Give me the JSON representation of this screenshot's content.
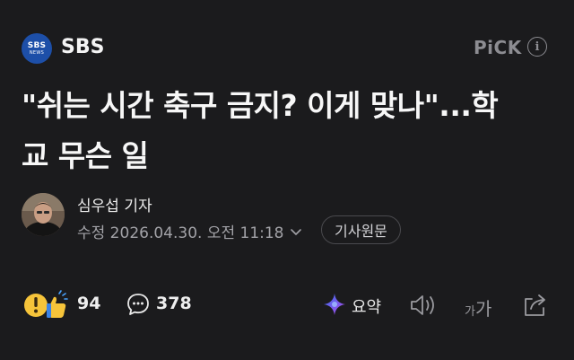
{
  "press": {
    "logo_top": "SBS",
    "logo_bottom": "NEWS",
    "name": "SBS"
  },
  "badge": {
    "pick": "PiCK",
    "info_glyph": "i"
  },
  "article": {
    "title": "\"쉬는 시간 축구 금지? 이게 맞나\"...학교 무슨 일",
    "reporter": "심우섭 기자",
    "modified": "수정 2026.04.30. 오전 11:18",
    "original_button": "기사원문"
  },
  "actions": {
    "reactions_count": "94",
    "comments_count": "378",
    "summary_label": "요약",
    "font_small": "가",
    "font_large": "가"
  },
  "colors": {
    "background": "#1b1b1d",
    "press_logo": "#1d4fa8",
    "summary_gradient": [
      "#3a6df0",
      "#b04be8"
    ]
  },
  "icons": [
    "info-icon",
    "chevron-down-icon",
    "reaction-emoji-icon",
    "comment-icon",
    "ai-summary-icon",
    "speaker-icon",
    "font-size-icon",
    "share-icon"
  ]
}
